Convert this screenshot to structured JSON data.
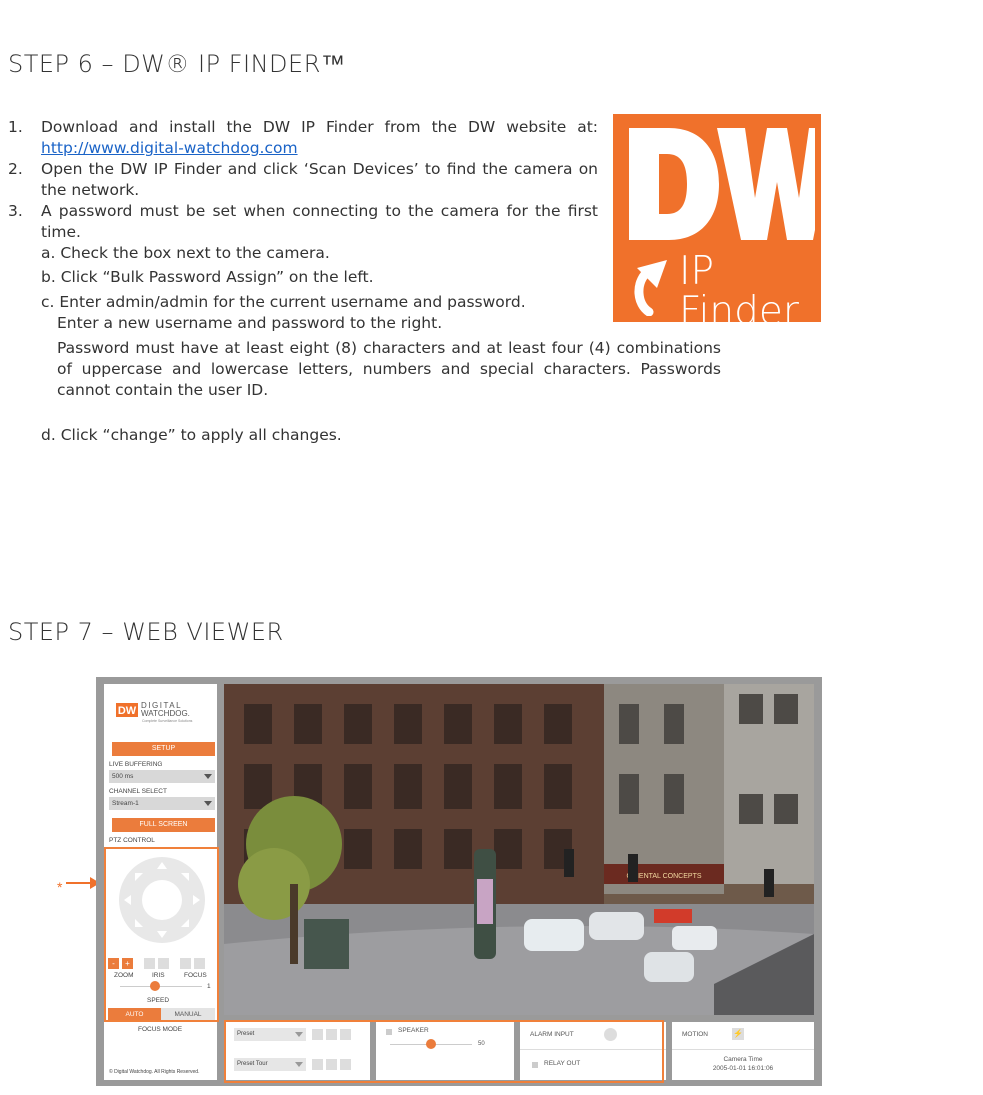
{
  "step6": {
    "title": "STEP 6 – DW® IP FINDER™",
    "items": [
      {
        "num": "1.",
        "text_before": "Download and install the DW IP Finder from the DW website at: ",
        "link": "http://www.digital-watchdog.com"
      },
      {
        "num": "2.",
        "text": "Open the DW IP Finder and click ‘Scan Devices’ to find the camera on the network."
      },
      {
        "num": "3.",
        "text": "A password must be set when connecting to the camera for the first time."
      }
    ],
    "sub": {
      "a": "a. Check the box next to the camera.",
      "b": "b. Click “Bulk Password Assign” on the left.",
      "c1": "c. Enter admin/admin for the current username and password.",
      "c2": "Enter a new username and password to the right.",
      "c3": "Password must have at least eight (8) characters and at least four (4) combinations of uppercase and lowercase letters, numbers and special characters. Passwords cannot contain the user ID.",
      "d": "d. Click “change” to apply all changes."
    },
    "logo": {
      "line1": "IP",
      "line2": "Finder",
      "color": "#f0712b"
    }
  },
  "step7": {
    "title": "STEP 7 – WEB VIEWER",
    "callout": "*",
    "viewer": {
      "brand": {
        "name": "DIGITAL",
        "name2": "WATCHDOG.",
        "tagline": "Complete Surveillance Solutions"
      },
      "setup": "SETUP",
      "live_buffering_label": "LIVE BUFFERING",
      "live_buffering_value": "500 ms",
      "channel_select_label": "CHANNEL SELECT",
      "channel_select_value": "Stream-1",
      "full_screen": "FULL SCREEN",
      "ptz_control": "PTZ CONTROL",
      "zoom": "ZOOM",
      "iris": "IRIS",
      "focus": "FOCUS",
      "speed": "SPEED",
      "speed_value": 1,
      "auto": "AUTO",
      "manual": "MANUAL",
      "focus_mode": "FOCUS MODE",
      "copyright": "© Digital Watchdog. All Rights Reserved.",
      "preset": "Preset",
      "preset_tour": "Preset Tour",
      "speaker": "SPEAKER",
      "speaker_value": "50",
      "alarm_input": "ALARM INPUT",
      "relay_out": "RELAY OUT",
      "motion": "MOTION",
      "camera_time_label": "Camera Time",
      "camera_time_value": "2005-01-01 16:01:06",
      "sign": "ORIENTAL CONCEPTS"
    }
  }
}
